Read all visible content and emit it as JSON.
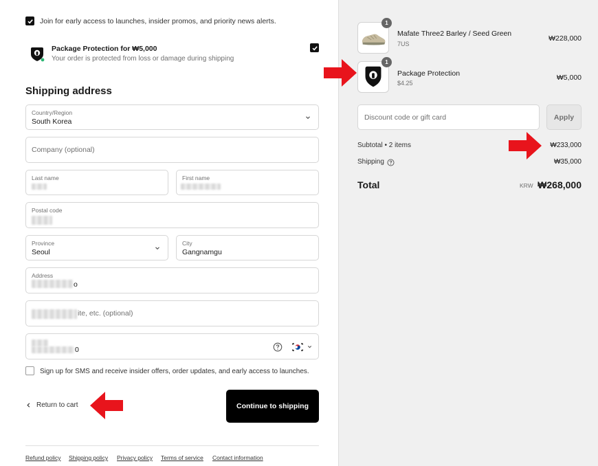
{
  "newsletter": {
    "label": "Join for early access to launches, insider promos, and priority news alerts.",
    "checked": true
  },
  "protection": {
    "title": "Package Protection for ₩5,000",
    "subtitle": "Your order is protected from loss or damage during shipping",
    "checked": true
  },
  "shipping": {
    "heading": "Shipping address",
    "country": {
      "label": "Country/Region",
      "value": "South Korea"
    },
    "company": {
      "placeholder": "Company (optional)"
    },
    "last_name": {
      "label": "Last name"
    },
    "first_name": {
      "label": "First name"
    },
    "postal": {
      "label": "Postal code"
    },
    "province": {
      "label": "Province",
      "value": "Seoul"
    },
    "city": {
      "label": "City",
      "value": "Gangnamgu"
    },
    "address": {
      "label": "Address",
      "value_tail": "o"
    },
    "apartment": {
      "placeholder_tail": "ite, etc. (optional)"
    },
    "phone": {
      "value_tail": "0"
    },
    "sms_label": "Sign up for SMS and receive insider offers, order updates, and early access to launches."
  },
  "nav": {
    "return_label": "Return to cart",
    "continue_label": "Continue to shipping"
  },
  "footer": [
    "Refund policy",
    "Shipping policy",
    "Privacy policy",
    "Terms of service",
    "Contact information"
  ],
  "summary": {
    "items": [
      {
        "name": "Mafate Three2 Barley / Seed Green",
        "variant": "7US",
        "price": "₩228,000",
        "qty": "1"
      },
      {
        "name": "Package Protection",
        "variant": "$4.25",
        "price": "₩5,000",
        "qty": "1"
      }
    ],
    "discount_placeholder": "Discount code or gift card",
    "apply_label": "Apply",
    "subtotal_label": "Subtotal • 2 items",
    "subtotal_value": "₩233,000",
    "shipping_label": "Shipping",
    "shipping_value": "₩35,000",
    "total_label": "Total",
    "currency": "KRW",
    "total_value": "₩268,000"
  },
  "colors": {
    "accent_arrow": "#e8141c",
    "primary_button": "#000000"
  }
}
